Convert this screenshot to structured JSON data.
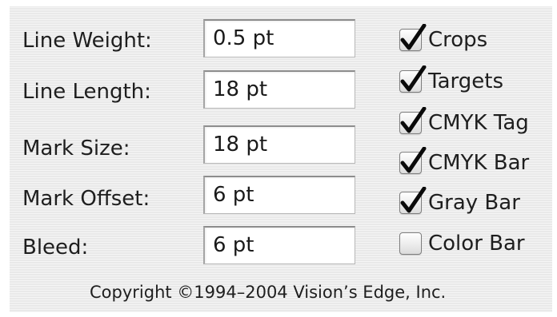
{
  "fields": [
    {
      "label": "Line Weight:",
      "value": "0.5 pt"
    },
    {
      "label": "Line Length:",
      "value": "18 pt"
    },
    {
      "label": "Mark Size:",
      "value": "18 pt"
    },
    {
      "label": "Mark Offset:",
      "value": "6 pt"
    },
    {
      "label": "Bleed:",
      "value": "6 pt"
    }
  ],
  "checkboxes": [
    {
      "label": "Crops",
      "checked": true
    },
    {
      "label": "Targets",
      "checked": true
    },
    {
      "label": "CMYK Tag",
      "checked": true
    },
    {
      "label": "CMYK Bar",
      "checked": true
    },
    {
      "label": "Gray Bar",
      "checked": true
    },
    {
      "label": "Color Bar",
      "checked": false
    }
  ],
  "copyright": "Copyright ©1994–2004 Vision’s Edge, Inc.",
  "colors": {
    "panel_bg": "#e9e9e9",
    "checkmark": "#0a0a0a",
    "field_bg": "#ffffff"
  },
  "icons": {
    "checkmark": "checkmark-icon"
  }
}
